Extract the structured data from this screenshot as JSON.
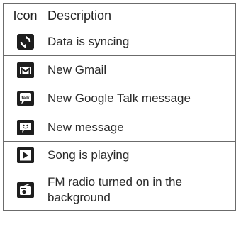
{
  "header": {
    "icon": "Icon",
    "description": "Description"
  },
  "rows": [
    {
      "icon": "sync-icon",
      "description": "Data is syncing"
    },
    {
      "icon": "gmail-icon",
      "description": "New Gmail"
    },
    {
      "icon": "google-talk-icon",
      "description": "New Google Talk message"
    },
    {
      "icon": "message-icon",
      "description": "New message"
    },
    {
      "icon": "play-icon",
      "description": "Song is playing"
    },
    {
      "icon": "fm-radio-icon",
      "description": "FM radio turned on in the background"
    }
  ],
  "colors": {
    "icon_bg": "#1e1e1e",
    "icon_fg": "#ffffff",
    "border": "#6b6b6b"
  }
}
